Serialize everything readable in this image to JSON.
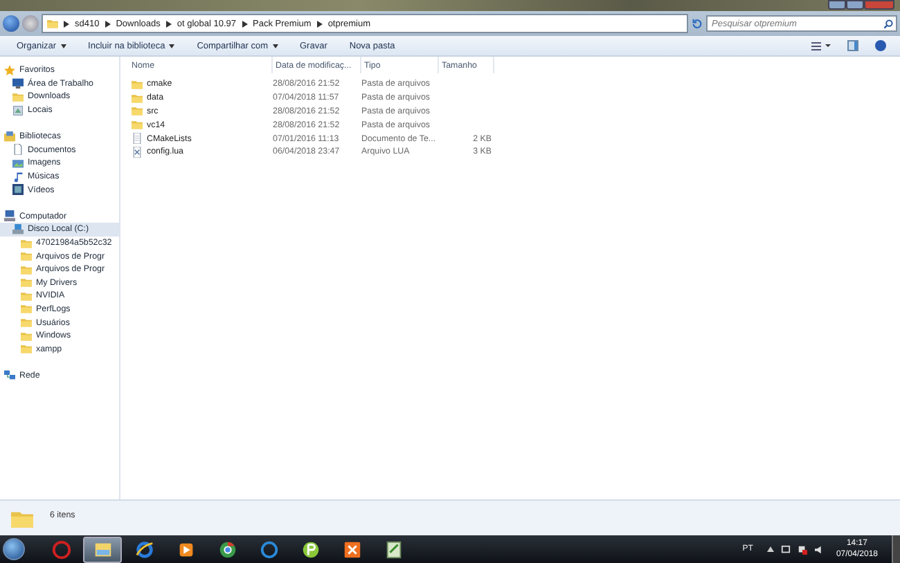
{
  "address": {
    "breadcrumb": [
      "sd410",
      "Downloads",
      "ot global 10.97",
      "Pack Premium",
      "otpremium"
    ]
  },
  "search": {
    "placeholder": "Pesquisar otpremium"
  },
  "toolbar": [
    {
      "label": "Organizar",
      "dropdown": true
    },
    {
      "label": "Incluir na biblioteca",
      "dropdown": true
    },
    {
      "label": "Compartilhar com",
      "dropdown": true
    },
    {
      "label": "Gravar",
      "dropdown": false
    },
    {
      "label": "Nova pasta",
      "dropdown": false
    }
  ],
  "sidebar": {
    "groups": [
      {
        "label": "Favoritos",
        "kind": "star",
        "selected": false,
        "children": [
          {
            "label": "Área de Trabalho",
            "kind": "desktop",
            "selected": false
          },
          {
            "label": "Downloads",
            "kind": "folder",
            "selected": false
          },
          {
            "label": "Locais",
            "kind": "places",
            "selected": false
          }
        ]
      },
      {
        "label": "Bibliotecas",
        "kind": "library",
        "selected": false,
        "children": [
          {
            "label": "Documentos",
            "kind": "document",
            "selected": false
          },
          {
            "label": "Imagens",
            "kind": "image",
            "selected": false
          },
          {
            "label": "Músicas",
            "kind": "music",
            "selected": false
          },
          {
            "label": "Vídeos",
            "kind": "video",
            "selected": false
          }
        ]
      },
      {
        "label": "Computador",
        "kind": "computer",
        "selected": false,
        "children": [
          {
            "label": "Disco Local (C:)",
            "kind": "drive",
            "selected": true,
            "children": [
              {
                "label": "47021984a5b52c32",
                "kind": "folder",
                "selected": false
              },
              {
                "label": "Arquivos de Progr",
                "kind": "folder",
                "selected": false
              },
              {
                "label": "Arquivos de Progr",
                "kind": "folder",
                "selected": false
              },
              {
                "label": "My Drivers",
                "kind": "folder",
                "selected": false
              },
              {
                "label": "NVIDIA",
                "kind": "folder",
                "selected": false
              },
              {
                "label": "PerfLogs",
                "kind": "folder",
                "selected": false
              },
              {
                "label": "Usuários",
                "kind": "folder",
                "selected": false
              },
              {
                "label": "Windows",
                "kind": "folder",
                "selected": false
              },
              {
                "label": "xampp",
                "kind": "folder",
                "selected": false
              }
            ]
          }
        ]
      },
      {
        "label": "Rede",
        "kind": "network",
        "selected": false
      }
    ]
  },
  "table": {
    "columns": [
      "Nome",
      "Data de modificaç...",
      "Tipo",
      "Tamanho"
    ],
    "rows": [
      {
        "kind": "folder",
        "name": "cmake",
        "modified": "28/08/2016 21:52",
        "type": "Pasta de arquivos"
      },
      {
        "kind": "folder",
        "name": "data",
        "modified": "07/04/2018 11:57",
        "type": "Pasta de arquivos"
      },
      {
        "kind": "folder",
        "name": "src",
        "modified": "28/08/2016 21:52",
        "type": "Pasta de arquivos"
      },
      {
        "kind": "folder",
        "name": "vc14",
        "modified": "28/08/2016 21:52",
        "type": "Pasta de arquivos"
      },
      {
        "kind": "text",
        "name": "CMakeLists",
        "modified": "07/01/2016 11:13",
        "type": "Documento de Te...",
        "size": "2 KB"
      },
      {
        "kind": "lua",
        "name": "config.lua",
        "modified": "06/04/2018 23:47",
        "type": "Arquivo LUA",
        "size": "3 KB"
      }
    ]
  },
  "status_bar": {
    "count": "6 itens"
  },
  "taskbar": {
    "apps": [
      {
        "kind": "shield",
        "selected": false
      },
      {
        "kind": "explorer",
        "selected": true
      },
      {
        "kind": "ie",
        "selected": false
      },
      {
        "kind": "media",
        "selected": false
      },
      {
        "kind": "chrome",
        "selected": false
      },
      {
        "kind": "cleaner",
        "selected": false
      },
      {
        "kind": "green",
        "selected": false
      },
      {
        "kind": "xampp",
        "selected": false
      },
      {
        "kind": "editor",
        "selected": false
      }
    ],
    "language": "PT",
    "time": "14:17",
    "date": "07/04/2018"
  }
}
